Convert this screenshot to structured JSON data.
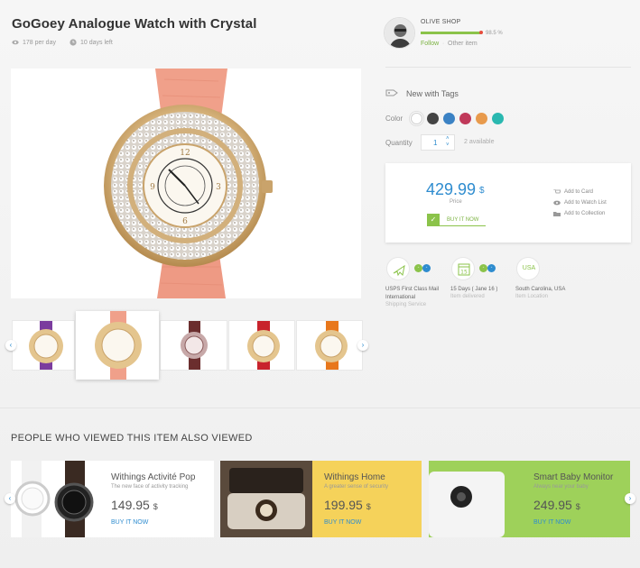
{
  "product": {
    "title": "GoGoey Analogue Watch with Crystal",
    "views": "178 per day",
    "days_left": "10 days left",
    "icons": {
      "views": "eye-icon",
      "time": "clock-icon"
    }
  },
  "shop": {
    "name": "OLIVE SHOP",
    "rating_percent": "98.5 %",
    "rating_fraction": 0.985,
    "follow": "Follow",
    "separator": "·",
    "other": "Other item"
  },
  "options": {
    "condition": "New with Tags",
    "color_label": "Color",
    "colors": [
      "#ffffff",
      "#444444",
      "#3b82c4",
      "#c0395a",
      "#e89a4c",
      "#2ab8b0"
    ],
    "quantity_label": "Quantity",
    "quantity_value": "1",
    "available": "2 available"
  },
  "purchase": {
    "price": "429.99",
    "currency": "$",
    "price_label": "Price",
    "buy_label": "BUY IT NOW",
    "actions": [
      "Add to Card",
      "Add to Watch List",
      "Add to Collection"
    ]
  },
  "shipping": [
    {
      "line1": "USPS First Class Mail",
      "line2": "International",
      "sub": "Shipping Service"
    },
    {
      "line1": "15 Days ( Jane 16 )",
      "line2": "",
      "sub": "Item delivered"
    },
    {
      "line1": "South Carolina, USA",
      "line2": "",
      "sub": "Item Location",
      "badge": "USA"
    }
  ],
  "calendar_day": "15",
  "mini_badges": [
    "◦",
    "◦"
  ],
  "related": {
    "heading": "PEOPLE WHO VIEWED THIS ITEM ALSO VIEWED",
    "items": [
      {
        "title": "Withings Activité Pop",
        "subtitle": "The new face of activity tracking",
        "price": "149.95",
        "currency": "$",
        "buy": "BUY IT NOW"
      },
      {
        "title": "Withings Home",
        "subtitle": "A greater sense of security",
        "price": "199.95",
        "currency": "$",
        "buy": "BUY IT NOW"
      },
      {
        "title": "Smart Baby Monitor",
        "subtitle": "Always near your baby",
        "price": "249.95",
        "currency": "$",
        "buy": "BUY IT NOW"
      }
    ]
  },
  "colors": {
    "accent_blue": "#2e8ccf",
    "accent_green": "#8bc34a",
    "card_yellow": "#f5d25a",
    "card_green": "#9ed15a"
  }
}
